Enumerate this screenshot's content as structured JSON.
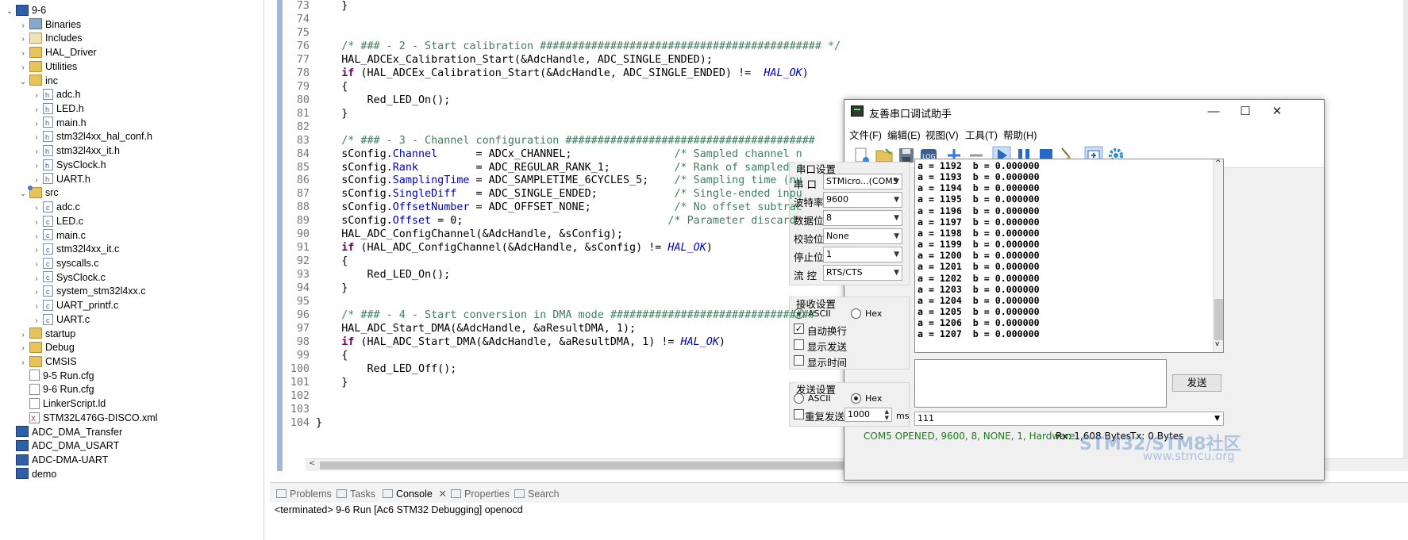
{
  "explorer": {
    "items": [
      {
        "label": "9-6",
        "icon": "project-icon",
        "arrow": "v",
        "indent": 0
      },
      {
        "label": "Binaries",
        "icon": "binaries-icon",
        "arrow": ">",
        "indent": 1
      },
      {
        "label": "Includes",
        "icon": "includes-icon",
        "arrow": ">",
        "indent": 1
      },
      {
        "label": "HAL_Driver",
        "icon": "folder-icon",
        "arrow": ">",
        "indent": 1
      },
      {
        "label": "Utilities",
        "icon": "folder-icon",
        "arrow": ">",
        "indent": 1
      },
      {
        "label": "inc",
        "icon": "folder-icon",
        "arrow": "v",
        "indent": 1
      },
      {
        "label": "adc.h",
        "icon": "header-file-icon",
        "arrow": ">",
        "indent": 2
      },
      {
        "label": "LED.h",
        "icon": "header-file-icon",
        "arrow": ">",
        "indent": 2
      },
      {
        "label": "main.h",
        "icon": "header-file-icon",
        "arrow": ">",
        "indent": 2
      },
      {
        "label": "stm32l4xx_hal_conf.h",
        "icon": "header-file-icon",
        "arrow": ">",
        "indent": 2
      },
      {
        "label": "stm32l4xx_it.h",
        "icon": "header-file-icon",
        "arrow": ">",
        "indent": 2
      },
      {
        "label": "SysClock.h",
        "icon": "header-file-icon",
        "arrow": ">",
        "indent": 2
      },
      {
        "label": "UART.h",
        "icon": "header-file-icon",
        "arrow": ">",
        "indent": 2
      },
      {
        "label": "src",
        "icon": "source-folder-icon",
        "arrow": "v",
        "indent": 1
      },
      {
        "label": "adc.c",
        "icon": "c-file-icon",
        "arrow": ">",
        "indent": 2
      },
      {
        "label": "LED.c",
        "icon": "c-file-icon",
        "arrow": ">",
        "indent": 2
      },
      {
        "label": "main.c",
        "icon": "c-file-icon",
        "arrow": ">",
        "indent": 2
      },
      {
        "label": "stm32l4xx_it.c",
        "icon": "c-file-icon",
        "arrow": ">",
        "indent": 2
      },
      {
        "label": "syscalls.c",
        "icon": "c-file-icon",
        "arrow": ">",
        "indent": 2
      },
      {
        "label": "SysClock.c",
        "icon": "c-file-icon",
        "arrow": ">",
        "indent": 2
      },
      {
        "label": "system_stm32l4xx.c",
        "icon": "c-file-icon",
        "arrow": ">",
        "indent": 2
      },
      {
        "label": "UART_printf.c",
        "icon": "c-file-icon",
        "arrow": ">",
        "indent": 2
      },
      {
        "label": "UART.c",
        "icon": "c-file-icon",
        "arrow": ">",
        "indent": 2
      },
      {
        "label": "startup",
        "icon": "folder-icon",
        "arrow": ">",
        "indent": 1
      },
      {
        "label": "Debug",
        "icon": "folder-icon",
        "arrow": ">",
        "indent": 1
      },
      {
        "label": "CMSIS",
        "icon": "folder-icon",
        "arrow": ">",
        "indent": 1
      },
      {
        "label": "9-5 Run.cfg",
        "icon": "config-file-icon",
        "arrow": "",
        "indent": 1
      },
      {
        "label": "9-6 Run.cfg",
        "icon": "config-file-icon",
        "arrow": "",
        "indent": 1
      },
      {
        "label": "LinkerScript.ld",
        "icon": "config-file-icon",
        "arrow": "",
        "indent": 1
      },
      {
        "label": "STM32L476G-DISCO.xml",
        "icon": "xml-file-icon",
        "arrow": "",
        "indent": 1
      },
      {
        "label": "ADC_DMA_Transfer",
        "icon": "project-icon",
        "arrow": "",
        "indent": 0
      },
      {
        "label": "ADC_DMA_USART",
        "icon": "project-icon",
        "arrow": "",
        "indent": 0
      },
      {
        "label": "ADC-DMA-UART",
        "icon": "project-icon",
        "arrow": "",
        "indent": 0
      },
      {
        "label": "demo",
        "icon": "project-icon",
        "arrow": "",
        "indent": 0
      }
    ]
  },
  "editor": {
    "lines": [
      {
        "n": "73",
        "html": "    }"
      },
      {
        "n": "74",
        "html": ""
      },
      {
        "n": "75",
        "html": ""
      },
      {
        "n": "76",
        "html": "    <span class=\"cm\">/* ### - 2 - Start calibration ############################################ */</span>"
      },
      {
        "n": "77",
        "html": "    HAL_ADCEx_Calibration_Start(&amp;AdcHandle, ADC_SINGLE_ENDED);"
      },
      {
        "n": "78",
        "html": "    <span class=\"kw\">if</span> (HAL_ADCEx_Calibration_Start(&amp;AdcHandle, ADC_SINGLE_ENDED) !=  <span class=\"mac\">HAL_OK</span>)"
      },
      {
        "n": "79",
        "html": "    {"
      },
      {
        "n": "80",
        "html": "        Red_LED_On();"
      },
      {
        "n": "81",
        "html": "    }"
      },
      {
        "n": "82",
        "html": ""
      },
      {
        "n": "83",
        "html": "    <span class=\"cm\">/* ### - 3 - Channel configuration #######################################</span>"
      },
      {
        "n": "84",
        "html": "    sConfig.<span class=\"fld\">Channel</span>      = ADCx_CHANNEL;                <span class=\"cm\">/* Sampled channel n</span>"
      },
      {
        "n": "85",
        "html": "    sConfig.<span class=\"fld\">Rank</span>         = ADC_REGULAR_RANK_1;          <span class=\"cm\">/* Rank of sampled c</span>"
      },
      {
        "n": "86",
        "html": "    sConfig.<span class=\"fld\">SamplingTime</span> = ADC_SAMPLETIME_6CYCLES_5;    <span class=\"cm\">/* Sampling time (nu</span>"
      },
      {
        "n": "87",
        "html": "    sConfig.<span class=\"fld\">SingleDiff</span>   = ADC_SINGLE_ENDED;            <span class=\"cm\">/* Single-ended inpu</span>"
      },
      {
        "n": "88",
        "html": "    sConfig.<span class=\"fld\">OffsetNumber</span> = ADC_OFFSET_NONE;             <span class=\"cm\">/* No offset subtrac</span>"
      },
      {
        "n": "89",
        "html": "    sConfig.<span class=\"fld\">Offset</span> = 0;                                <span class=\"cm\">/* Parameter discard</span>"
      },
      {
        "n": "90",
        "html": "    HAL_ADC_ConfigChannel(&amp;AdcHandle, &amp;sConfig);"
      },
      {
        "n": "91",
        "html": "    <span class=\"kw\">if</span> (HAL_ADC_ConfigChannel(&amp;AdcHandle, &amp;sConfig) != <span class=\"mac\">HAL_OK</span>)"
      },
      {
        "n": "92",
        "html": "    {"
      },
      {
        "n": "93",
        "html": "        Red_LED_On();"
      },
      {
        "n": "94",
        "html": "    }"
      },
      {
        "n": "95",
        "html": ""
      },
      {
        "n": "96",
        "html": "    <span class=\"cm\">/* ### - 4 - Start conversion in DMA mode ################################</span>"
      },
      {
        "n": "97",
        "html": "    HAL_ADC_Start_DMA(&amp;AdcHandle, &amp;aResultDMA, 1);"
      },
      {
        "n": "98",
        "html": "    <span class=\"kw\">if</span> (HAL_ADC_Start_DMA(&amp;AdcHandle, &amp;aResultDMA, 1) != <span class=\"mac\">HAL_OK</span>)"
      },
      {
        "n": "99",
        "html": "    {"
      },
      {
        "n": "100",
        "html": "        Red_LED_Off();"
      },
      {
        "n": "101",
        "html": "    }"
      },
      {
        "n": "102",
        "html": ""
      },
      {
        "n": "103",
        "html": ""
      },
      {
        "n": "104",
        "html": "}"
      }
    ]
  },
  "bottom": {
    "tabs": [
      "Problems",
      "Tasks",
      "Console",
      "Properties",
      "Search"
    ],
    "active_tab": "Console",
    "console_status": "<terminated> 9-6 Run [Ac6 STM32 Debugging] openocd"
  },
  "serial": {
    "title": "友善串口调试助手",
    "menu": [
      "文件(F)",
      "编辑(E)",
      "视图(V)",
      "工具(T)",
      "帮助(H)"
    ],
    "port_group": "串口设置",
    "port_label": "串  口",
    "port_value": "STMicro...(COM5",
    "baud_label": "波特率",
    "baud_value": "9600",
    "databits_label": "数据位",
    "databits_value": "8",
    "parity_label": "校验位",
    "parity_value": "None",
    "stopbits_label": "停止位",
    "stopbits_value": "1",
    "flow_label": "流  控",
    "flow_value": "RTS/CTS",
    "rx_group": "接收设置",
    "rx_ascii": "ASCII",
    "rx_hex": "Hex",
    "auto_wrap": "自动换行",
    "show_send": "显示发送",
    "show_time": "显示时间",
    "tx_group": "发送设置",
    "tx_ascii": "ASCII",
    "tx_hex": "Hex",
    "repeat_send": "重复发送",
    "repeat_interval": "1000",
    "repeat_unit": "ms",
    "send_button": "发送",
    "history_value": "111",
    "rx_lines": [
      "a = 1192  b = 0.000000",
      "a = 1193  b = 0.000000",
      "a = 1194  b = 0.000000",
      "a = 1195  b = 0.000000",
      "a = 1196  b = 0.000000",
      "a = 1197  b = 0.000000",
      "a = 1198  b = 0.000000",
      "a = 1199  b = 0.000000",
      "a = 1200  b = 0.000000",
      "a = 1201  b = 0.000000",
      "a = 1202  b = 0.000000",
      "a = 1203  b = 0.000000",
      "a = 1204  b = 0.000000",
      "a = 1205  b = 0.000000",
      "a = 1206  b = 0.000000",
      "a = 1207  b = 0.000000"
    ],
    "status_port": "COM5 OPENED, 9600, 8, NONE, 1, Hardware",
    "status_rx": "Rx: 1,608 Bytes",
    "status_tx": "Tx: 0 Bytes",
    "colors": {
      "status_green": "#1a7f1a",
      "play_blue": "#2468c8"
    }
  },
  "watermark": {
    "text": "STM32/STM8社区",
    "url": "www.stmcu.org"
  }
}
